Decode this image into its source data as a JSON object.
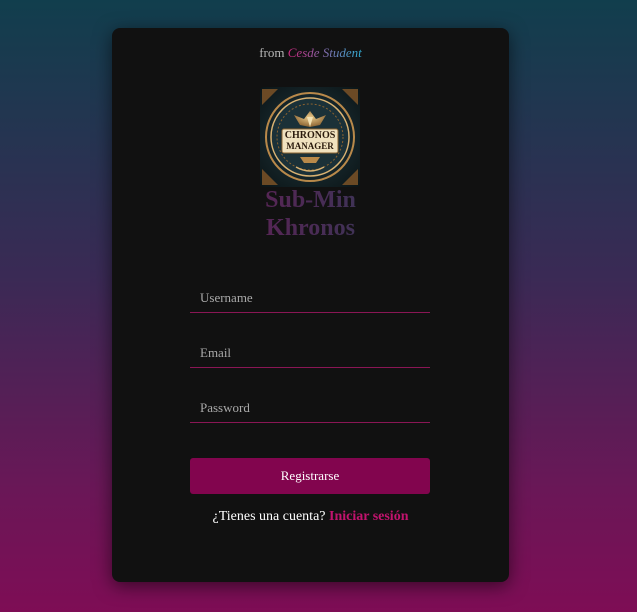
{
  "header": {
    "from_prefix": "from",
    "brand": "Cesde Student"
  },
  "logo": {
    "line1": "CHRONOS",
    "line2": "MANAGER"
  },
  "title": {
    "line1": "Sub-Min",
    "line2": "Khronos"
  },
  "form": {
    "username_placeholder": "Username",
    "email_placeholder": "Email",
    "password_placeholder": "Password",
    "submit_label": "Registrarse"
  },
  "footer": {
    "question": "¿Tienes una cuenta?",
    "login_link": "Iniciar sesión"
  },
  "colors": {
    "accent": "#82054e",
    "link": "#c2136e",
    "card": "#111111"
  }
}
